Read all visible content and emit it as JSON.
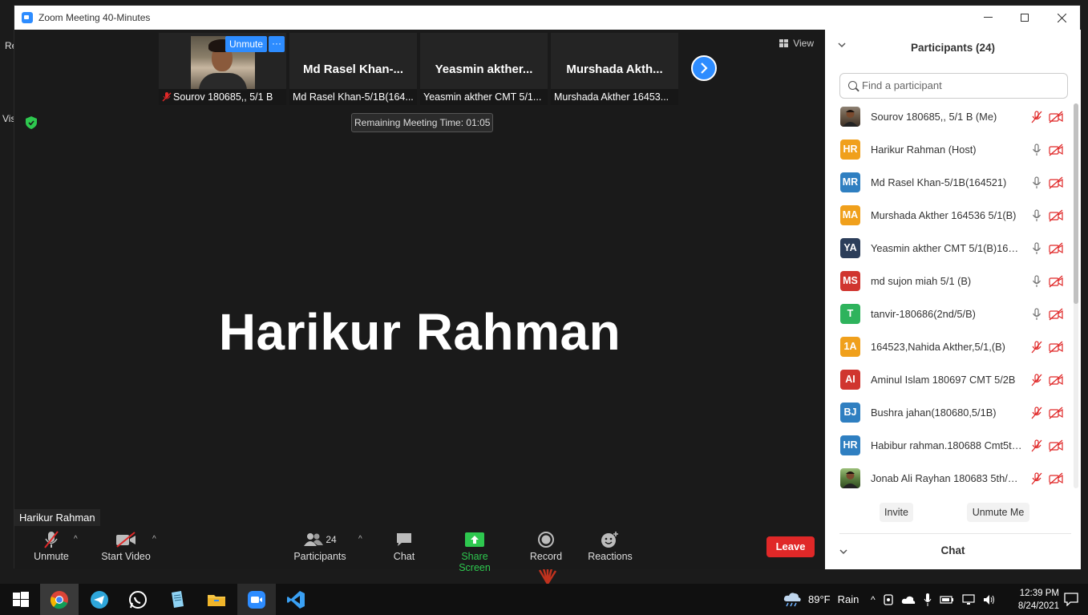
{
  "desktop": {
    "edge_text_1": "Re",
    "edge_text_2": "Vis"
  },
  "window": {
    "title": "Zoom Meeting 40-Minutes",
    "minimize": "—",
    "maximize": "☐",
    "close": "✕"
  },
  "gallery": {
    "tiles": [
      {
        "big_name": "",
        "label": "Sourov 180685,, 5/1 B",
        "has_photo": true
      },
      {
        "big_name": "Md Rasel Khan-...",
        "label": "Md Rasel Khan-5/1B(164..."
      },
      {
        "big_name": "Yeasmin akther...",
        "label": "Yeasmin akther CMT 5/1..."
      },
      {
        "big_name": "Murshada Akth...",
        "label": "Murshada Akther 16453..."
      }
    ],
    "unmute_label": "Unmute",
    "more_label": "···"
  },
  "view_label": "View",
  "remaining_time": "Remaining Meeting Time: 01:05",
  "active_speaker": "Harikur Rahman",
  "name_tag": "Harikur Rahman",
  "toolbar": {
    "unmute": "Unmute",
    "start_video": "Start Video",
    "participants": "Participants",
    "participants_count": "24",
    "chat": "Chat",
    "share_screen": "Share Screen",
    "record": "Record",
    "reactions": "Reactions",
    "leave": "Leave"
  },
  "panel": {
    "title": "Participants (24)",
    "search_placeholder": "Find a participant",
    "participants": [
      {
        "initials": "",
        "name": "Sourov 180685,, 5/1 B (Me)",
        "color": "photo",
        "mic": "muted"
      },
      {
        "initials": "HR",
        "name": "Harikur Rahman (Host)",
        "color": "#f0a01c",
        "mic": "on"
      },
      {
        "initials": "MR",
        "name": "Md Rasel Khan-5/1B(164521)",
        "color": "#2f7fc1",
        "mic": "on"
      },
      {
        "initials": "MA",
        "name": "Murshada Akther 164536 5/1(B)",
        "color": "#f0a01c",
        "mic": "on"
      },
      {
        "initials": "YA",
        "name": "Yeasmin akther CMT 5/1(B)1645...",
        "color": "#2c3e5a",
        "mic": "on"
      },
      {
        "initials": "MS",
        "name": "md sujon miah 5/1 (B)",
        "color": "#d0352f",
        "mic": "on"
      },
      {
        "initials": "T",
        "name": "tanvir-180686(2nd/5/B)",
        "color": "#2eb35c",
        "mic": "on"
      },
      {
        "initials": "1A",
        "name": "164523,Nahida Akther,5/1,(B)",
        "color": "#f0a01c",
        "mic": "muted"
      },
      {
        "initials": "AI",
        "name": "Aminul Islam 180697 CMT 5/2B",
        "color": "#d0352f",
        "mic": "muted"
      },
      {
        "initials": "BJ",
        "name": "Bushra jahan(180680,5/1B)",
        "color": "#2f7fc1",
        "mic": "muted"
      },
      {
        "initials": "HR",
        "name": "Habibur rahman.180688 Cmt5th...",
        "color": "#2f7fc1",
        "mic": "muted"
      },
      {
        "initials": "",
        "name": "Jonab Ali Rayhan 180683 5th/1 ...",
        "color": "photo2",
        "mic": "muted"
      }
    ],
    "invite": "Invite",
    "unmute_me": "Unmute Me",
    "chat_title": "Chat"
  },
  "taskbar": {
    "weather_temp": "89°F",
    "weather_desc": "Rain",
    "time": "12:39 PM",
    "date": "8/24/2021"
  }
}
